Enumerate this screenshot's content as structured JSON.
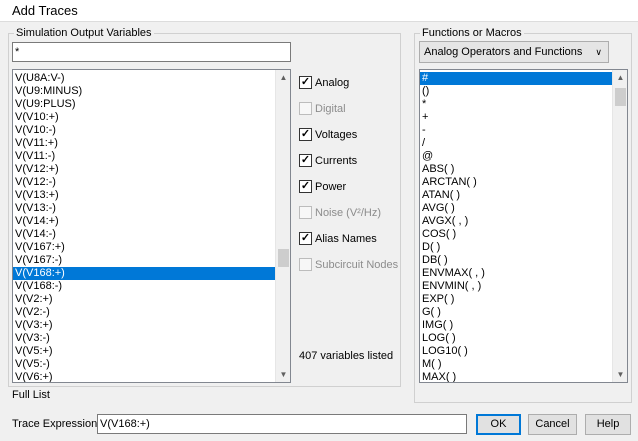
{
  "window": {
    "title": "Add Traces"
  },
  "sim_output": {
    "group_label": "Simulation Output Variables",
    "filter_value": "*",
    "items": [
      "V(U8A:V-)",
      "V(U9:MINUS)",
      "V(U9:PLUS)",
      "V(V10:+)",
      "V(V10:-)",
      "V(V11:+)",
      "V(V11:-)",
      "V(V12:+)",
      "V(V12:-)",
      "V(V13:+)",
      "V(V13:-)",
      "V(V14:+)",
      "V(V14:-)",
      "V(V167:+)",
      "V(V167:-)",
      "V(V168:+)",
      "V(V168:-)",
      "V(V2:+)",
      "V(V2:-)",
      "V(V3:+)",
      "V(V3:-)",
      "V(V5:+)",
      "V(V5:-)",
      "V(V6:+)"
    ],
    "selected_item": "V(V168:+)"
  },
  "options": {
    "analog": {
      "label": "Analog",
      "checked": true,
      "enabled": true
    },
    "digital": {
      "label": "Digital",
      "checked": false,
      "enabled": false
    },
    "voltages": {
      "label": "Voltages",
      "checked": true,
      "enabled": true
    },
    "currents": {
      "label": "Currents",
      "checked": true,
      "enabled": true
    },
    "power": {
      "label": "Power",
      "checked": true,
      "enabled": true
    },
    "noise": {
      "label": "Noise (V²/Hz)",
      "checked": false,
      "enabled": false
    },
    "alias_names": {
      "label": "Alias Names",
      "checked": true,
      "enabled": true
    },
    "subcircuit_nodes": {
      "label": "Subcircuit Nodes",
      "checked": false,
      "enabled": false
    },
    "variables_count": "407 variables listed"
  },
  "functions": {
    "group_label": "Functions or Macros",
    "dropdown_value": "Analog Operators and Functions",
    "items": [
      "#",
      "()",
      "*",
      "+",
      "-",
      "/",
      "@",
      "ABS( )",
      "ARCTAN( )",
      "ATAN( )",
      "AVG( )",
      "AVGX( , )",
      "COS( )",
      "D( )",
      "DB( )",
      "ENVMAX( , )",
      "ENVMIN( , )",
      "EXP( )",
      "G( )",
      "IMG( )",
      "LOG( )",
      "LOG10( )",
      "M( )",
      "MAX( )"
    ],
    "selected_item": "#"
  },
  "footer": {
    "full_list_label": "Full List",
    "trace_expression_label": "Trace Expression:",
    "trace_expression_value": "V(V168:+)",
    "ok_label": "OK",
    "cancel_label": "Cancel",
    "help_label": "Help"
  },
  "colors": {
    "selection": "#0078d7",
    "background": "#f0f0f0"
  }
}
